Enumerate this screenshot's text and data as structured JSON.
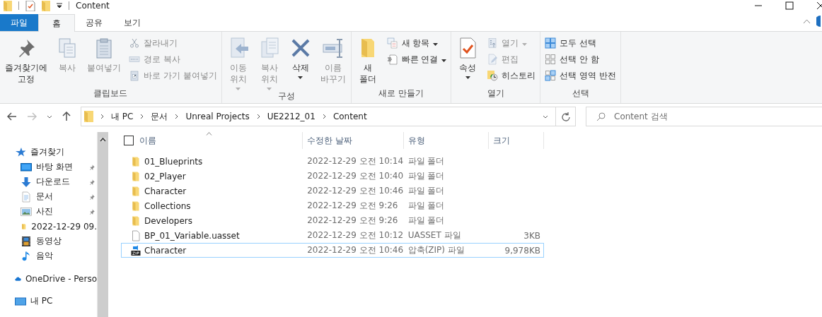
{
  "window": {
    "title": "Content"
  },
  "ribbon": {
    "tabs": [
      {
        "label": "파일",
        "kind": "file",
        "selected": false
      },
      {
        "label": "홈",
        "kind": "tab",
        "selected": true
      },
      {
        "label": "공유",
        "kind": "tab",
        "selected": false
      },
      {
        "label": "보기",
        "kind": "tab",
        "selected": false
      }
    ],
    "groups": [
      {
        "label": "클립보드",
        "commands": [
          {
            "kind": "large",
            "lines": [
              "즐겨찾기에",
              "고정"
            ],
            "disabled": false,
            "menu": false
          },
          {
            "kind": "large",
            "lines": [
              "복사"
            ],
            "disabled": true,
            "menu": false
          },
          {
            "kind": "large",
            "lines": [
              "붙여넣기"
            ],
            "disabled": true,
            "menu": false
          },
          {
            "kind": "stack",
            "items": [
              {
                "label": "잘라내기",
                "disabled": true,
                "menu": false
              },
              {
                "label": "경로 복사",
                "disabled": true,
                "menu": false
              },
              {
                "label": "바로 가기 붙여넣기",
                "disabled": true,
                "menu": false
              }
            ]
          }
        ]
      },
      {
        "label": "구성",
        "commands": [
          {
            "kind": "large",
            "lines": [
              "이동",
              "위치"
            ],
            "disabled": true,
            "menu": true
          },
          {
            "kind": "large",
            "lines": [
              "복사",
              "위치"
            ],
            "disabled": true,
            "menu": true
          },
          {
            "kind": "large",
            "lines": [
              "삭제"
            ],
            "disabled": false,
            "menu": true
          },
          {
            "kind": "large",
            "lines": [
              "이름",
              "바꾸기"
            ],
            "disabled": true,
            "menu": false
          }
        ]
      },
      {
        "label": "새로 만들기",
        "commands": [
          {
            "kind": "large",
            "lines": [
              "새",
              "폴더"
            ],
            "disabled": false,
            "menu": false
          },
          {
            "kind": "stack",
            "items": [
              {
                "label": "새 항목",
                "disabled": false,
                "menu": true
              },
              {
                "label": "빠른 연결",
                "disabled": false,
                "menu": true
              }
            ]
          }
        ]
      },
      {
        "label": "열기",
        "commands": [
          {
            "kind": "large",
            "lines": [
              "속성"
            ],
            "disabled": false,
            "menu": true
          },
          {
            "kind": "stack",
            "items": [
              {
                "label": "열기",
                "disabled": true,
                "menu": true
              },
              {
                "label": "편집",
                "disabled": true,
                "menu": false
              },
              {
                "label": "히스토리",
                "disabled": false,
                "menu": false
              }
            ]
          }
        ]
      },
      {
        "label": "선택",
        "commands": [
          {
            "kind": "stack",
            "items": [
              {
                "label": "모두 선택",
                "disabled": false,
                "menu": false
              },
              {
                "label": "선택 안 함",
                "disabled": false,
                "menu": false
              },
              {
                "label": "선택 영역 반전",
                "disabled": false,
                "menu": false
              }
            ]
          }
        ]
      }
    ]
  },
  "navigation": {
    "back_disabled": false,
    "forward_disabled": true,
    "breadcrumbs": [
      "내 PC",
      "문서",
      "Unreal Projects",
      "UE2212_01",
      "Content"
    ],
    "search": {
      "placeholder": "Content 검색"
    }
  },
  "sidebar": {
    "sections": [
      {
        "label": "즐겨찾기",
        "children": [
          {
            "label": "바탕 화면",
            "pinned": true
          },
          {
            "label": "다운로드",
            "pinned": true
          },
          {
            "label": "문서",
            "pinned": true
          },
          {
            "label": "사진",
            "pinned": true
          },
          {
            "label": "2022-12-29 09.",
            "pinned": false
          },
          {
            "label": "동영상",
            "pinned": false
          },
          {
            "label": "음악",
            "pinned": false
          }
        ]
      },
      {
        "label": "OneDrive - Perso"
      },
      {
        "label": "내 PC"
      }
    ]
  },
  "table": {
    "columns": [
      "이름",
      "수정한 날짜",
      "유형",
      "크기"
    ],
    "select_all_checked": false,
    "rows": [
      {
        "kind": "folder",
        "name": "01_Blueprints",
        "modified": "2022-12-29 오전 10:14",
        "type": "파일 폴더",
        "focused": false
      },
      {
        "kind": "folder",
        "name": "02_Player",
        "modified": "2022-12-29 오전 10:40",
        "type": "파일 폴더",
        "focused": false
      },
      {
        "kind": "folder",
        "name": "Character",
        "modified": "2022-12-29 오전 10:46",
        "type": "파일 폴더",
        "focused": false
      },
      {
        "kind": "folder",
        "name": "Collections",
        "modified": "2022-12-29 오전 9:26",
        "type": "파일 폴더",
        "focused": false
      },
      {
        "kind": "folder",
        "name": "Developers",
        "modified": "2022-12-29 오전 9:26",
        "type": "파일 폴더",
        "focused": false
      },
      {
        "kind": "file",
        "name": "BP_01_Variable.uasset",
        "modified": "2022-12-29 오전 10:12",
        "type": "UASSET 파일",
        "size": "3KB",
        "focused": false
      },
      {
        "kind": "zip",
        "name": "Character",
        "modified": "2022-12-29 오전 10:46",
        "type": "압축(ZIP) 파일",
        "size": "9,978KB",
        "focused": true
      }
    ]
  }
}
